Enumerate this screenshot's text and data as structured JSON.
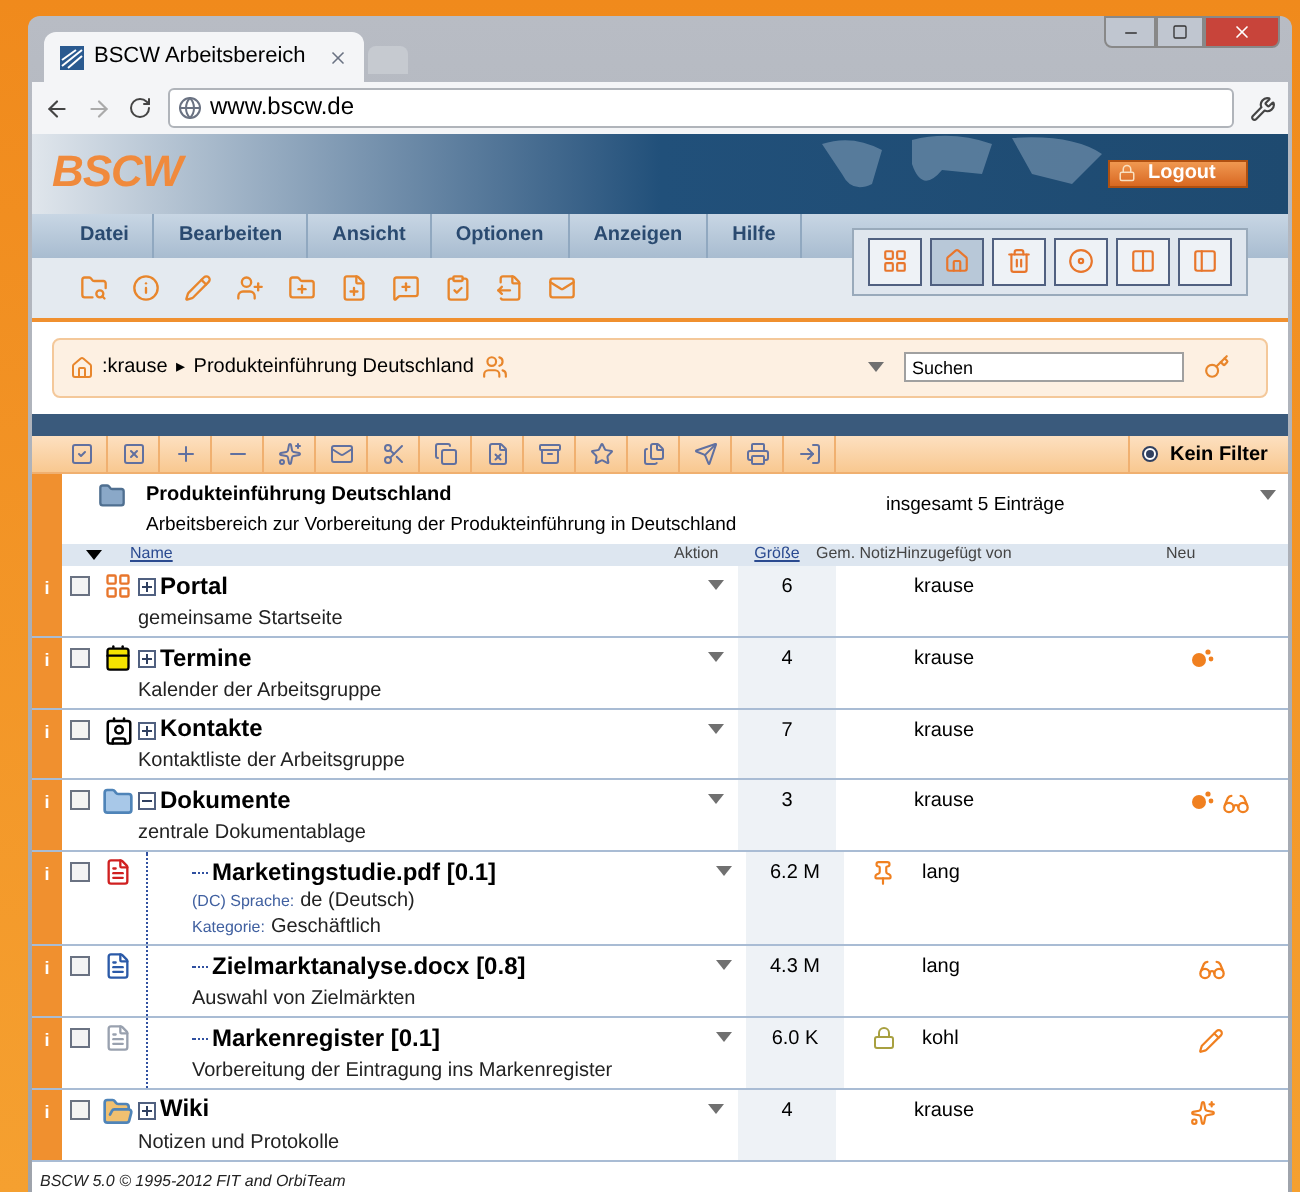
{
  "browser": {
    "tab_title": "BSCW Arbeitsbereich",
    "url": "www.bscw.de"
  },
  "header": {
    "logo": "BSCW",
    "logout": "Logout"
  },
  "menu": [
    "Datei",
    "Bearbeiten",
    "Ansicht",
    "Optionen",
    "Anzeigen",
    "Hilfe"
  ],
  "breadcrumb": {
    "user": ":krause",
    "separator": "▸",
    "current": "Produkteinführung Deutschland"
  },
  "search": {
    "value": "Suchen"
  },
  "filter": {
    "label": "Kein Filter"
  },
  "folder": {
    "title": "Produkteinführung Deutschland",
    "description": "Arbeitsbereich zur Vorbereitung der Produkteinführung in Deutschland",
    "count": "insgesamt 5 Einträge"
  },
  "columns": {
    "name": "Name",
    "action": "Aktion",
    "size": "Größe",
    "note": "Gem. Notiz",
    "added_by": "Hinzugefügt von",
    "new": "Neu"
  },
  "rows": [
    {
      "kind": "portal",
      "info": "i",
      "name": "Portal",
      "description": "gemeinsame Startseite",
      "size": "6",
      "added_by": "krause",
      "checked": false,
      "expanded": false
    },
    {
      "kind": "calendar",
      "info": "i",
      "name": "Termine",
      "description": "Kalender der Arbeitsgruppe",
      "size": "4",
      "added_by": "krause",
      "checked": false,
      "expanded": false,
      "marks": [
        {
          "kind": "new"
        }
      ]
    },
    {
      "kind": "contacts",
      "info": "i",
      "name": "Kontakte",
      "description": "Kontaktliste der Arbeitsgruppe",
      "size": "7",
      "added_by": "krause",
      "checked": false,
      "expanded": false
    },
    {
      "kind": "folder",
      "info": "i",
      "name": "Dokumente",
      "description": "zentrale Dokumentablage",
      "size": "3",
      "added_by": "krause",
      "checked": false,
      "expanded": true,
      "marks": [
        {
          "kind": "new"
        },
        {
          "kind": "read"
        }
      ],
      "children": [
        {
          "kind": "pdf",
          "info": "i",
          "name": "Marketingstudie.pdf [0.1]",
          "meta": [
            {
              "label": "(DC) Sprache:",
              "value": "de (Deutsch)"
            },
            {
              "label": "Kategorie:",
              "value": "Geschäftlich"
            }
          ],
          "size": "6.2 M",
          "added_by": "lang",
          "checked": false,
          "note": {
            "kind": "pin"
          }
        },
        {
          "kind": "word",
          "info": "i",
          "name": "Zielmarktanalyse.docx [0.8]",
          "description": "Auswahl von Zielmärkten",
          "size": "4.3 M",
          "added_by": "lang",
          "checked": false,
          "marks": [
            {
              "kind": "read"
            }
          ]
        },
        {
          "kind": "text",
          "info": "i",
          "name": "Markenregister [0.1]",
          "description": "Vorbereitung der Eintragung ins Markenregister",
          "size": "6.0 K",
          "added_by": "kohl",
          "checked": false,
          "note": {
            "kind": "lock"
          },
          "marks": [
            {
              "kind": "edited"
            }
          ]
        }
      ]
    },
    {
      "kind": "wiki",
      "info": "i",
      "name": "Wiki",
      "description": "Notizen und Protokolle",
      "size": "4",
      "added_by": "krause",
      "checked": false,
      "expanded": false,
      "marks": [
        {
          "kind": "star"
        }
      ]
    }
  ],
  "footer": "BSCW 5.0 © 1995-2012 FIT and OrbiTeam"
}
